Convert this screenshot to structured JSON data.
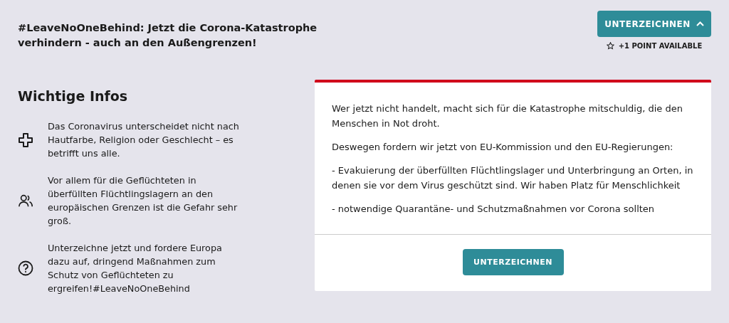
{
  "header": {
    "title": "#LeaveNoOneBehind: Jetzt die Corona-Katastrophe verhindern - auch an den Außengrenzen!",
    "sign_button": {
      "label": "UNTERZEICHNEN",
      "expanded": true
    },
    "points": "+1 POINT AVAILABLE"
  },
  "info": {
    "heading": "Wichtige Infos",
    "items": [
      {
        "kind": "plus",
        "text": "Das Coronavirus unterscheidet nicht nach Hautfarbe, Religion oder Geschlecht – es betrifft uns alle."
      },
      {
        "kind": "people",
        "text": "Vor allem für die Geflüchteten in überfüllten Flüchtlingslagern an den europäischen Grenzen ist die Gefahr sehr groß."
      },
      {
        "kind": "question",
        "text": "Unterzeichne jetzt und fordere Europa dazu auf, dringend Maßnahmen zum Schutz von Geflüchteten zu ergreifen!#LeaveNoOneBehind"
      }
    ]
  },
  "petition": {
    "paragraphs": [
      "Wer jetzt nicht handelt, macht sich für die Katastrophe mitschuldig, die den Menschen in Not droht.",
      "Deswegen fordern wir jetzt von EU-Kommission und den EU-Regierungen:",
      "- Evakuierung der überfüllten Flüchtlingslager und Unterbringung an Orten, in denen sie vor dem Virus geschützt sind. Wir haben Platz für Menschlichkeit",
      "- notwendige Quarantäne- und Schutzmaßnahmen vor Corona sollten"
    ],
    "sign_button": "UNTERZEICHNEN"
  }
}
